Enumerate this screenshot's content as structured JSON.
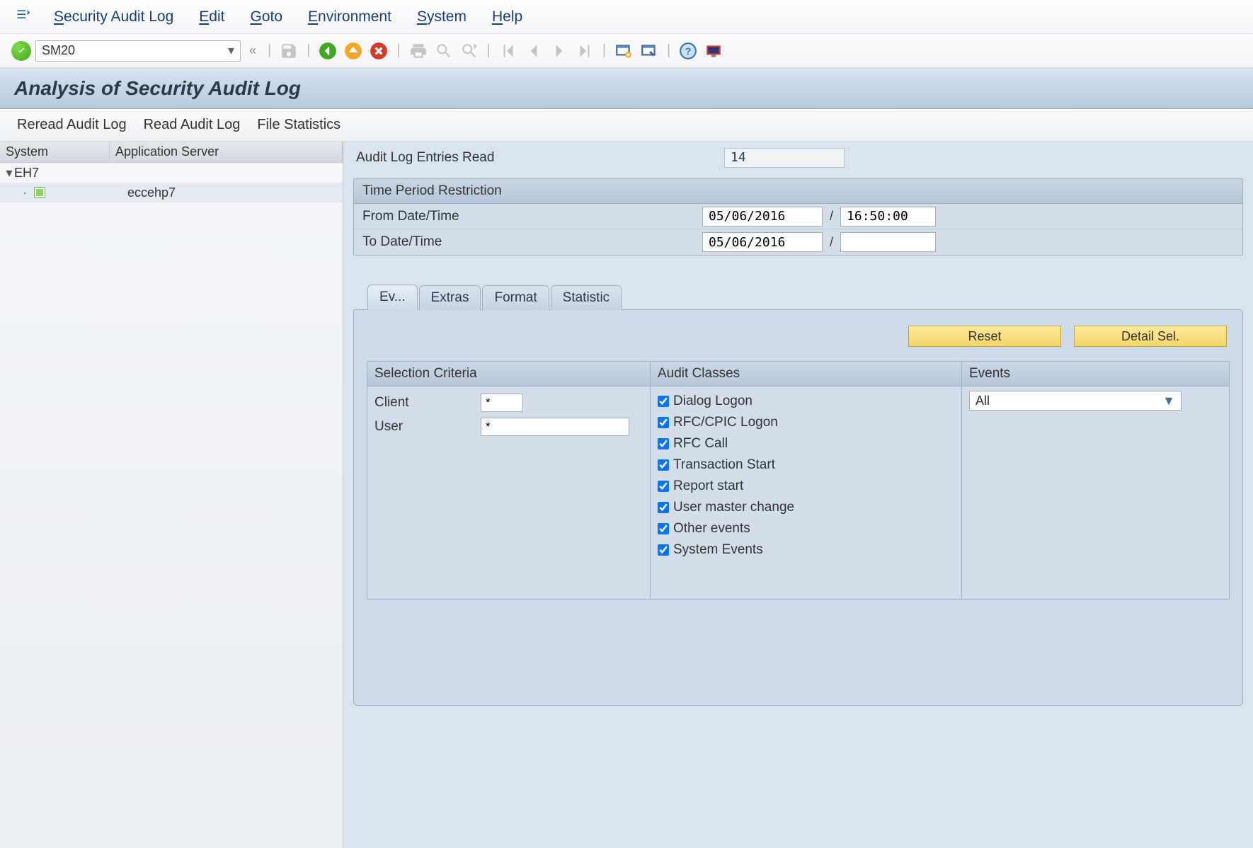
{
  "menubar": {
    "items": [
      {
        "pre": "S",
        "label": "ecurity Audit Log"
      },
      {
        "pre": "E",
        "label": "dit"
      },
      {
        "pre": "G",
        "label": "oto"
      },
      {
        "pre": "E",
        "label": "nvironment"
      },
      {
        "pre": "S",
        "label": "ystem"
      },
      {
        "pre": "H",
        "label": "elp"
      }
    ]
  },
  "toolbar": {
    "tcode": "SM20",
    "back_hint": "«"
  },
  "title": "Analysis of Security Audit Log",
  "appbar": {
    "btn_reread": "Reread Audit Log",
    "btn_read": "Read Audit Log",
    "btn_stats": "File Statistics"
  },
  "sidebar": {
    "header": {
      "col1": "System",
      "col2": "Application Server"
    },
    "rows": [
      {
        "indent": 0,
        "expanded": true,
        "label": "EH7"
      },
      {
        "indent": 1,
        "server_icon": true,
        "label": "eccehp7"
      }
    ]
  },
  "entries_read": {
    "label": "Audit Log Entries Read",
    "value": "14"
  },
  "period_box": {
    "title": "Time Period Restriction",
    "from_label": "From Date/Time",
    "to_label": "To Date/Time",
    "from_date": "05/06/2016",
    "from_time": "16:50:00",
    "to_date": "05/06/2016",
    "to_time": ""
  },
  "tabs": {
    "items": [
      "Ev...",
      "Extras",
      "Format",
      "Statistic"
    ],
    "active_index": 0
  },
  "buttons": {
    "reset": "Reset",
    "detail": "Detail Sel."
  },
  "selection": {
    "title": "Selection Criteria",
    "client_label": "Client",
    "client_value": "*",
    "user_label": "User",
    "user_value": "*"
  },
  "audit_classes": {
    "title": "Audit Classes",
    "items": [
      "Dialog Logon",
      "RFC/CPIC Logon",
      "RFC Call",
      "Transaction Start",
      "Report start",
      "User master change",
      "Other events",
      "System Events"
    ]
  },
  "events": {
    "title": "Events",
    "value": "All"
  }
}
